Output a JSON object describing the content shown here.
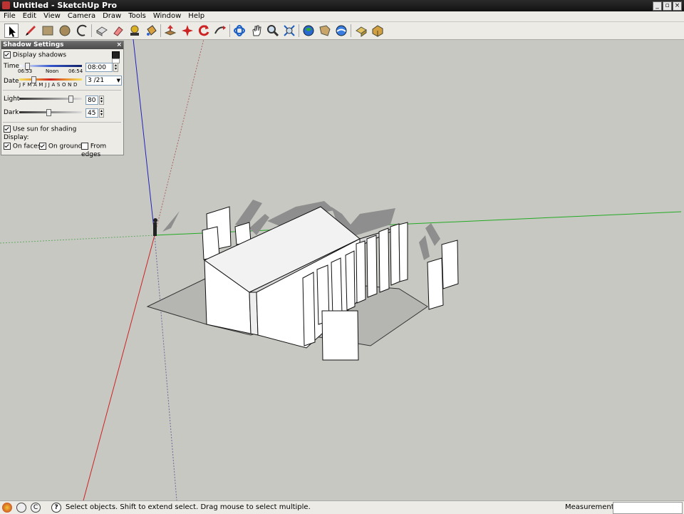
{
  "window": {
    "title": "Untitled - SketchUp Pro"
  },
  "menu": [
    "File",
    "Edit",
    "View",
    "Camera",
    "Draw",
    "Tools",
    "Window",
    "Help"
  ],
  "toolbar": {
    "tools": [
      {
        "name": "select-tool-icon",
        "interactable": true
      },
      {
        "name": "pencil-icon",
        "interactable": true
      },
      {
        "name": "rectangle-icon",
        "interactable": true
      },
      {
        "name": "circle-icon",
        "interactable": true
      },
      {
        "name": "arc-icon",
        "interactable": true
      },
      {
        "name": "make-component-icon",
        "interactable": true
      },
      {
        "name": "eraser-icon",
        "interactable": true
      },
      {
        "name": "tape-measure-icon",
        "interactable": true
      },
      {
        "name": "paint-bucket-icon",
        "interactable": true
      },
      {
        "name": "push-pull-icon",
        "interactable": true
      },
      {
        "name": "move-icon",
        "interactable": true
      },
      {
        "name": "rotate-icon",
        "interactable": true
      },
      {
        "name": "follow-me-icon",
        "interactable": true
      },
      {
        "name": "orbit-icon",
        "interactable": true
      },
      {
        "name": "pan-icon",
        "interactable": true
      },
      {
        "name": "zoom-icon",
        "interactable": true
      },
      {
        "name": "zoom-extents-icon",
        "interactable": true
      },
      {
        "name": "get-models-icon",
        "interactable": true
      },
      {
        "name": "share-model-icon",
        "interactable": true
      },
      {
        "name": "google-earth-icon",
        "interactable": true
      },
      {
        "name": "get-photo-texture-icon",
        "interactable": true
      },
      {
        "name": "extension-warehouse-icon",
        "interactable": true
      }
    ]
  },
  "shadow_panel": {
    "title": "Shadow Settings",
    "close": "×",
    "display_shadows": {
      "label": "Display shadows",
      "checked": true
    },
    "time": {
      "label": "Time",
      "start": "06:53",
      "mid": "Noon",
      "end": "06:54",
      "value": "08:00",
      "position": 0.12
    },
    "date": {
      "label": "Date",
      "months": "J F M A M J J A S O N D",
      "value": "3 /21",
      "position": 0.22
    },
    "light": {
      "label": "Light",
      "value": "80",
      "position": 0.8
    },
    "dark": {
      "label": "Dark",
      "value": "45",
      "position": 0.45
    },
    "use_sun": {
      "label": "Use sun for shading",
      "checked": true
    },
    "display_label": "Display:",
    "on_faces": {
      "label": "On faces",
      "checked": true
    },
    "on_ground": {
      "label": "On ground",
      "checked": true
    },
    "from_edges": {
      "label": "From edges",
      "checked": false
    }
  },
  "statusbar": {
    "hint": "Select objects. Shift to extend select. Drag mouse to select multiple.",
    "measurements_label": "Measurements",
    "measurements_value": ""
  },
  "colors": {
    "background": "#c8c8c3",
    "axis_red": "#cc2222",
    "axis_green": "#22aa22",
    "axis_blue": "#2222bb",
    "shadow": "#8e8e8e",
    "ground_shadow": "#b5b5b2"
  }
}
